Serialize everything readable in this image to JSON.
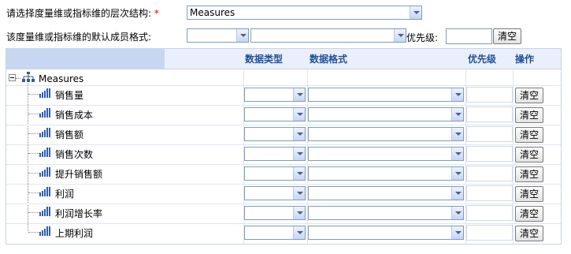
{
  "form": {
    "hierarchy_label": "请选择度量维或指标维的层次结构:",
    "required_mark": "*",
    "hierarchy_value": "Measures",
    "default_format_label": "该度量维或指标维的默认成员格式:",
    "priority_label": "优先级:",
    "clear_label": "清空"
  },
  "table": {
    "headers": [
      "数据类型",
      "数据格式",
      "优先级",
      "操作"
    ],
    "root": "Measures",
    "rows": [
      "销售量",
      "销售成本",
      "销售额",
      "销售次数",
      "提升销售额",
      "利润",
      "利润增长率",
      "上期利润"
    ],
    "clear_label": "清空"
  },
  "colors": {
    "header_text": "#1f4f9a",
    "header_bg": "#eaf0fb",
    "header_left_bg": "#c7d7f1",
    "icon_blue": "#2b5fb3"
  }
}
